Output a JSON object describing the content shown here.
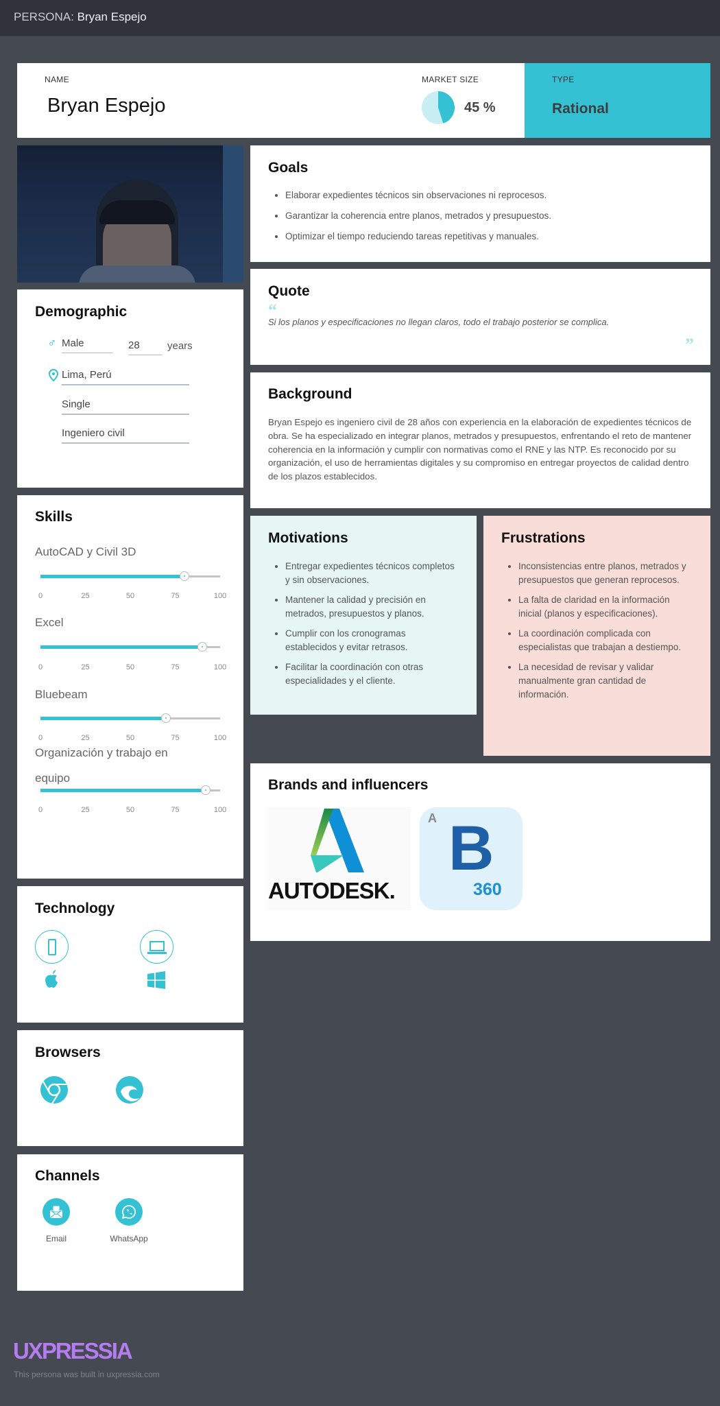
{
  "header": {
    "prefix": "PERSONA:",
    "name": "Bryan Espejo"
  },
  "summary": {
    "name_label": "NAME",
    "name": "Bryan Espejo",
    "market_label": "MARKET SIZE",
    "market_value": "45 %",
    "market_percent": 45,
    "type_label": "TYPE",
    "type_value": "Rational"
  },
  "colors": {
    "accent": "#34c1d4",
    "background": "#454951",
    "motivations_bg": "#e6f7f3",
    "frustrations_bg": "#f9ddd9",
    "logo": "#b57cf0"
  },
  "goals": {
    "title": "Goals",
    "items": [
      "Elaborar expedientes técnicos sin observaciones ni reprocesos.",
      "Garantizar la coherencia entre planos, metrados y presupuestos.",
      "Optimizar el tiempo reduciendo tareas repetitivas y manuales."
    ]
  },
  "quote": {
    "title": "Quote",
    "text": "Si los planos y especificaciones no llegan claros, todo el trabajo posterior se complica."
  },
  "background": {
    "title": "Background",
    "text": "Bryan Espejo es ingeniero civil de 28 años con experiencia en la elaboración de expedientes técnicos de obra. Se ha especializado en integrar planos, metrados y presupuestos, enfrentando el reto de mantener coherencia en la información y cumplir con normativas como el RNE y las NTP. Es reconocido por su organización, el uso de herramientas digitales y su compromiso en entregar proyectos de calidad dentro de los plazos establecidos."
  },
  "motivations": {
    "title": "Motivations",
    "items": [
      "Entregar expedientes técnicos completos y sin observaciones.",
      "Mantener la calidad y precisión en metrados, presupuestos y planos.",
      "Cumplir con los cronogramas establecidos y evitar retrasos.",
      "Facilitar la coordinación con otras especialidades y el cliente."
    ]
  },
  "frustrations": {
    "title": "Frustrations",
    "items": [
      "Inconsistencias entre planos, metrados y presupuestos que generan reprocesos.",
      "La falta de claridad en la información inicial (planos y especificaciones).",
      "La coordinación complicada con especialistas que trabajan a destiempo.",
      "La necesidad de revisar y validar manualmente gran cantidad de información."
    ]
  },
  "brands": {
    "title": "Brands and influencers",
    "autodesk": "AUTODESK.",
    "b360": "360",
    "b_letter": "B"
  },
  "demographic": {
    "title": "Demographic",
    "gender": "Male",
    "age": "28",
    "age_unit": "years",
    "location": "Lima, Perú",
    "status": "Single",
    "occupation": "Ingeniero civil"
  },
  "skills": {
    "title": "Skills",
    "ticks": [
      "0",
      "25",
      "50",
      "75",
      "100"
    ],
    "items": [
      {
        "label": "AutoCAD y Civil 3D",
        "value": 80
      },
      {
        "label": "Excel",
        "value": 90
      },
      {
        "label": "Bluebeam",
        "value": 70
      },
      {
        "label": "Organización y trabajo en equipo",
        "value": 92
      }
    ]
  },
  "technology": {
    "title": "Technology",
    "icons": [
      "mobile-icon",
      "laptop-icon",
      "apple-icon",
      "windows-icon"
    ]
  },
  "browsers": {
    "title": "Browsers",
    "icons": [
      "chrome-icon",
      "edge-icon"
    ]
  },
  "channels": {
    "title": "Channels",
    "items": [
      "Email",
      "WhatsApp"
    ]
  },
  "footer": {
    "logo": "UXPRESSIA",
    "note": "This persona was built in uxpressia.com"
  }
}
